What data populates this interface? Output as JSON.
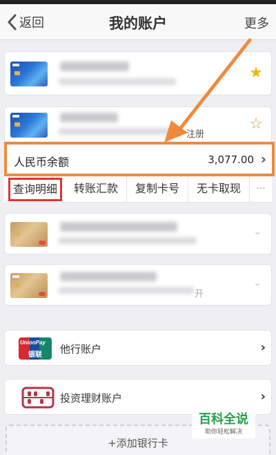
{
  "nav": {
    "back_label": "返回",
    "title": "我的账户",
    "more_label": "更多"
  },
  "cards": {
    "card2_suffix": "注册",
    "card4_suffix": "开"
  },
  "balance": {
    "label": "人民币余额",
    "amount": "3,077.00"
  },
  "actions": [
    "查询明细",
    "转账汇款",
    "复制卡号",
    "无卡取现",
    "···"
  ],
  "rows": {
    "other_banks": {
      "label": "他行账户",
      "logo_en": "UnionPay",
      "logo_cn": "银联"
    },
    "investment": {
      "label": "投资理财账户"
    }
  },
  "add_card_label": "+添加银行卡",
  "watermark": {
    "title": "百科全说",
    "subtitle": "助你轻松解决"
  },
  "colors": {
    "highlight_orange": "#ef8a3c",
    "highlight_red": "#e0322f",
    "star_gold": "#f2b90b"
  }
}
